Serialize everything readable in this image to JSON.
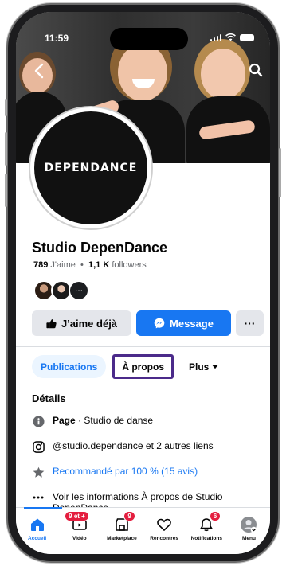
{
  "status": {
    "time": "11:59"
  },
  "profile": {
    "logo_text": "DEPENDANCE",
    "name": "Studio DepenDance",
    "likes_count": "789",
    "likes_label": "J'aime",
    "separator": "•",
    "followers_count": "1,1 K",
    "followers_label": "followers",
    "friends_more": "⋯"
  },
  "actions": {
    "like_label": "J’aime déjà",
    "message_label": "Message",
    "more_label": "···"
  },
  "tabs": [
    {
      "label": "Publications"
    },
    {
      "label": "À propos"
    },
    {
      "label": "Plus"
    }
  ],
  "details": {
    "title": "Détails",
    "category_bold": "Page",
    "category_text": " · Studio de danse",
    "links_text": "@studio.dependance et 2 autres liens",
    "recommend_text": "Recommandé par 100 % (15 avis)",
    "about_text": "Voir les informations À propos de Studio DepenDance"
  },
  "bottom_nav": [
    {
      "label": "Accueil",
      "icon": "home-icon"
    },
    {
      "label": "Vidéo",
      "icon": "video-icon",
      "badge": "9 et +"
    },
    {
      "label": "Marketplace",
      "icon": "marketplace-icon",
      "badge": "9"
    },
    {
      "label": "Rencontres",
      "icon": "heart-icon"
    },
    {
      "label": "Notifications",
      "icon": "bell-icon",
      "badge": "6"
    },
    {
      "label": "Menu",
      "icon": "menu-avatar-icon"
    }
  ],
  "colors": {
    "accent": "#1877f2",
    "badge": "#e41e3f",
    "highlight_box": "#4b2a8a"
  }
}
